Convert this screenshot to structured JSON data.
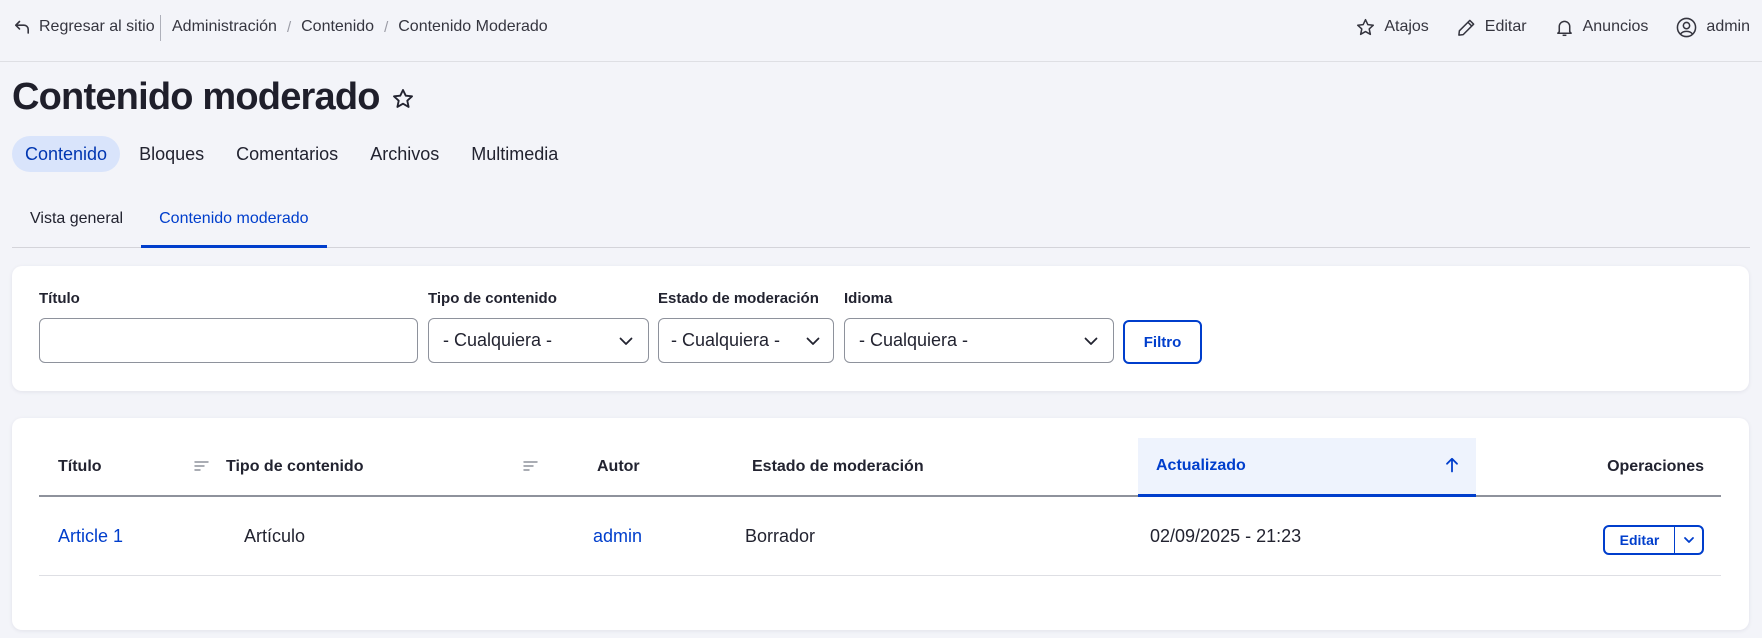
{
  "toolbar": {
    "back_label": "Regresar al sitio",
    "breadcrumb": [
      "Administración",
      "Contenido",
      "Contenido Moderado"
    ],
    "breadcrumb_separator": "/",
    "shortcuts_label": "Atajos",
    "edit_label": "Editar",
    "announcements_label": "Anuncios",
    "user_label": "admin"
  },
  "header": {
    "title": "Contenido moderado",
    "primary_tabs": [
      "Contenido",
      "Bloques",
      "Comentarios",
      "Archivos",
      "Multimedia"
    ],
    "primary_active": "Contenido",
    "secondary_tabs": [
      "Vista general",
      "Contenido moderado"
    ],
    "secondary_active": "Contenido moderado"
  },
  "filters": {
    "title_label": "Título",
    "title_value": "",
    "content_type_label": "Tipo de contenido",
    "content_type_value": "- Cualquiera -",
    "moderation_label": "Estado de moderación",
    "moderation_value": "- Cualquiera -",
    "language_label": "Idioma",
    "language_value": "- Cualquiera -",
    "submit_label": "Filtro"
  },
  "table": {
    "columns": {
      "title": "Título",
      "type": "Tipo de contenido",
      "author": "Autor",
      "state": "Estado de moderación",
      "updated": "Actualizado",
      "operations": "Operaciones"
    },
    "sorted_column": "Actualizado",
    "rows": [
      {
        "title": "Article 1",
        "type": "Artículo",
        "author": "admin",
        "state": "Borrador",
        "updated": "02/09/2025 - 21:23",
        "operation": "Editar"
      }
    ]
  },
  "colors": {
    "accent": "#003ecc",
    "active_pill_bg": "#d9e4fb",
    "page_bg": "#f3f4f9"
  }
}
